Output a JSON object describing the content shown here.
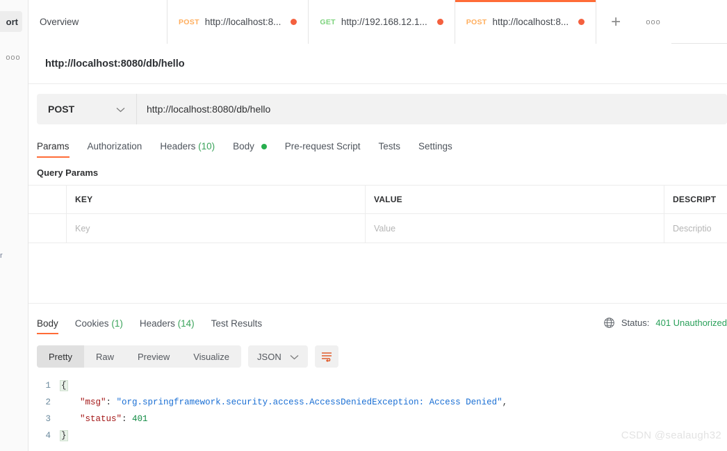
{
  "sidebar": {
    "import_label": "ort",
    "more_icon": "ooo",
    "stub_label": "r"
  },
  "tabs": {
    "items": [
      {
        "name": "overview",
        "verb": "",
        "label": "Overview",
        "dirty": false,
        "active": false
      },
      {
        "name": "tab-post-localhost-1",
        "verb": "POST",
        "label": "http://localhost:8...",
        "dirty": true,
        "active": false
      },
      {
        "name": "tab-get-192",
        "verb": "GET",
        "label": "http://192.168.12.1...",
        "dirty": true,
        "active": false
      },
      {
        "name": "tab-post-localhost-2",
        "verb": "POST",
        "label": "http://localhost:8...",
        "dirty": true,
        "active": true
      }
    ],
    "new_tab_label": "+",
    "more_label": "ooo"
  },
  "request": {
    "title": "http://localhost:8080/db/hello",
    "method": "POST",
    "method_chevron": "chevron-down",
    "url": "http://localhost:8080/db/hello",
    "tabs": [
      {
        "name": "params",
        "label": "Params",
        "count": "",
        "dot": false,
        "active": true
      },
      {
        "name": "authorization",
        "label": "Authorization",
        "count": "",
        "dot": false,
        "active": false
      },
      {
        "name": "headers",
        "label": "Headers",
        "count": "(10)",
        "dot": false,
        "active": false
      },
      {
        "name": "body",
        "label": "Body",
        "count": "",
        "dot": true,
        "active": false
      },
      {
        "name": "pre-request-script",
        "label": "Pre-request Script",
        "count": "",
        "dot": false,
        "active": false
      },
      {
        "name": "tests",
        "label": "Tests",
        "count": "",
        "dot": false,
        "active": false
      },
      {
        "name": "settings",
        "label": "Settings",
        "count": "",
        "dot": false,
        "active": false
      }
    ],
    "query_params_heading": "Query Params",
    "table": {
      "headers": [
        "",
        "KEY",
        "VALUE",
        "DESCRIPT"
      ],
      "rows": [
        {
          "key_placeholder": "Key",
          "value_placeholder": "Value",
          "desc_placeholder": "Descriptio"
        }
      ]
    }
  },
  "response": {
    "tabs": [
      {
        "name": "body",
        "label": "Body",
        "count": "",
        "active": true
      },
      {
        "name": "cookies",
        "label": "Cookies",
        "count": "(1)",
        "active": false
      },
      {
        "name": "headers",
        "label": "Headers",
        "count": "(14)",
        "active": false
      },
      {
        "name": "test-results",
        "label": "Test Results",
        "count": "",
        "active": false
      }
    ],
    "status_label": "Status:",
    "status_value": "401 Unauthorized",
    "status_color": "#2aa05a",
    "globe_icon": "globe-icon",
    "view_modes": [
      {
        "name": "pretty",
        "label": "Pretty",
        "active": true
      },
      {
        "name": "raw",
        "label": "Raw",
        "active": false
      },
      {
        "name": "preview",
        "label": "Preview",
        "active": false
      },
      {
        "name": "visualize",
        "label": "Visualize",
        "active": false
      }
    ],
    "format": "JSON",
    "format_chevron": "chevron-down",
    "wrap_icon": "wrap-text-icon",
    "body_lines": [
      {
        "num": "1",
        "tokens": [
          {
            "t": "brace",
            "v": "{"
          }
        ]
      },
      {
        "num": "2",
        "tokens": [
          {
            "t": "pun",
            "v": "    "
          },
          {
            "t": "key",
            "v": "\"msg\""
          },
          {
            "t": "pun",
            "v": ": "
          },
          {
            "t": "str",
            "v": "\"org.springframework.security.access.AccessDeniedException: Access Denied\""
          },
          {
            "t": "pun",
            "v": ","
          }
        ]
      },
      {
        "num": "3",
        "tokens": [
          {
            "t": "pun",
            "v": "    "
          },
          {
            "t": "key",
            "v": "\"status\""
          },
          {
            "t": "pun",
            "v": ": "
          },
          {
            "t": "num",
            "v": "401"
          }
        ]
      },
      {
        "num": "4",
        "tokens": [
          {
            "t": "brace",
            "v": "}"
          }
        ]
      }
    ]
  },
  "watermark": "CSDN @sealaugh32"
}
